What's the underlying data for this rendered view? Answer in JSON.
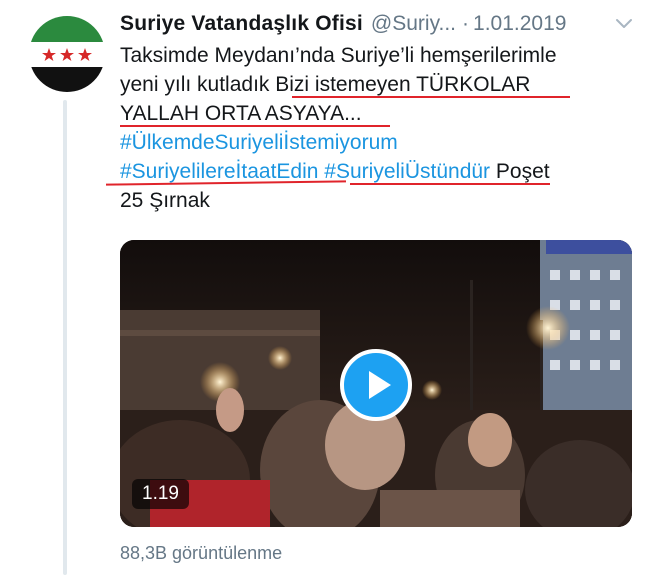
{
  "tweet": {
    "author_name": "Suriye Vatandaşlık Ofisi",
    "handle": "@Suriy...",
    "separator": "·",
    "date": "1.01.2019",
    "text_lines": {
      "l1": "Taksimde Meydanı’nda Suriye’li hemşerilerimle",
      "l2a": "yeni yılı kutladık ",
      "l2b": "Bizi istemeyen TÜRKOLAR",
      "l3": "YALLAH ORTA ASYAYA...",
      "l4": "#ÜlkemdeSuriyeliİstemiyorum",
      "l5a": "#SuriyelilereİtaatEdin",
      "l5b": " ",
      "l5c": "#SuriyeliÜstündür",
      "l5d": " Poşet",
      "l6": "25 Şırnak"
    },
    "video": {
      "duration": "1.19"
    },
    "views": "88,3B görüntülenme"
  },
  "colors": {
    "link": "#1b95e0",
    "accent_blue": "#1da1f2",
    "muted": "#657786",
    "annotation_red": "#e0242b",
    "flag_green": "#2b8a3e",
    "flag_red": "#d62828"
  },
  "icons": {
    "avatar": "syrian-opposition-flag",
    "menu": "chevron-down-icon",
    "play": "play-icon"
  }
}
